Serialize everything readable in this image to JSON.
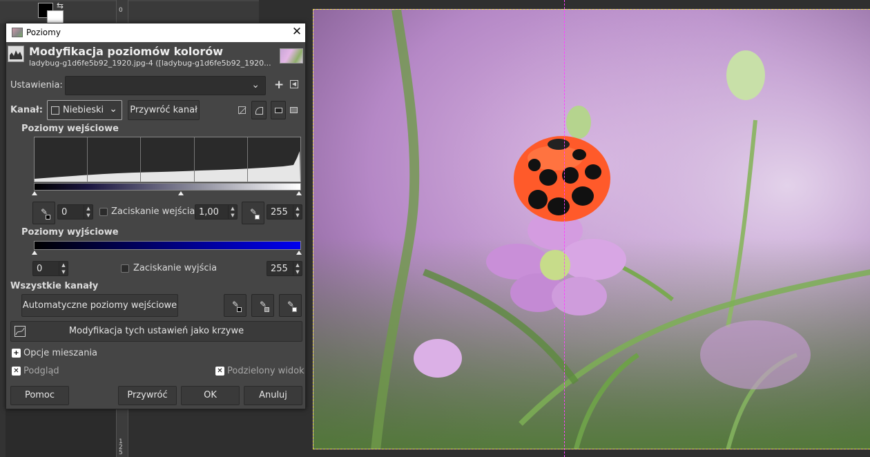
{
  "ruler": {
    "top_label": "0",
    "bottom_label": "125"
  },
  "dialog": {
    "title": "Poziomy",
    "close_glyph": "✕",
    "header_title": "Modyfikacja poziomów kolorów",
    "header_subtitle": "ladybug-g1d6fe5b92_1920.jpg-4 ([ladybug-g1d6fe5b92_1920...",
    "settings_label": "Ustawienia:",
    "settings_value": "",
    "channel_label": "Kanał:",
    "channel_value": "Niebieski",
    "reset_channel_button": "Przywróć kanał",
    "input_levels_title": "Poziomy wejściowe",
    "input_low": "0",
    "clamp_input_label": "Zaciskanie wejścia",
    "gamma": "1,00",
    "input_high": "255",
    "output_levels_title": "Poziomy wyjściowe",
    "output_low": "0",
    "clamp_output_label": "Zaciskanie wyjścia",
    "output_high": "255",
    "all_channels_title": "Wszystkie kanały",
    "auto_levels_button": "Automatyczne poziomy wejściowe",
    "edit_as_curves_button": "Modyfikacja tych ustawień jako krzywe",
    "blending_options_label": "Opcje mieszania",
    "preview_label": "Podgląd",
    "split_view_label": "Podzielony widok",
    "buttons": {
      "help": "Pomoc",
      "reset": "Przywróć",
      "ok": "OK",
      "cancel": "Anuluj"
    }
  },
  "histogram": {
    "grid_divisions": 5,
    "channel_color": "#0000f0"
  },
  "colors": {
    "dialog_bg": "#454545",
    "canvas_bg": "#2f2f2f",
    "selection_border": "#f0e050",
    "split_guide": "#ff40ff"
  }
}
